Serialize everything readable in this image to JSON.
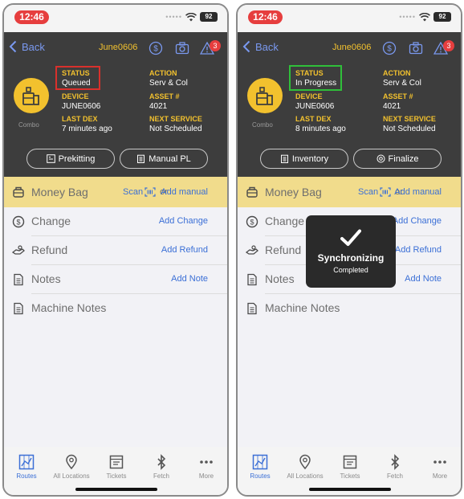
{
  "screens": [
    {
      "status_bar": {
        "time": "12:46",
        "battery": "92"
      },
      "nav": {
        "back_label": "Back",
        "title": "June0606",
        "alert_count": "3"
      },
      "header": {
        "machine_type": "Combo",
        "status_label": "STATUS",
        "status_value": "Queued",
        "action_label": "ACTION",
        "action_value": "Serv & Col",
        "device_label": "DEVICE",
        "device_value": "JUNE0606",
        "asset_label": "ASSET #",
        "asset_value": "4021",
        "lastdex_label": "LAST DEX",
        "lastdex_value": "7 minutes ago",
        "nextservice_label": "NEXT SERVICE",
        "nextservice_value": "Not Scheduled",
        "status_highlight_color": "#d9302c",
        "button_left": "Prekitting",
        "button_right": "Manual PL"
      },
      "rows": {
        "money_bag": {
          "label": "Money Bag",
          "scan": "Scan",
          "or": "or",
          "add": "Add manual"
        },
        "change": {
          "label": "Change",
          "action": "Add Change"
        },
        "refund": {
          "label": "Refund",
          "action": "Add Refund"
        },
        "notes": {
          "label": "Notes",
          "action": "Add Note"
        },
        "machine_notes": {
          "label": "Machine Notes"
        }
      }
    },
    {
      "status_bar": {
        "time": "12:46",
        "battery": "92"
      },
      "nav": {
        "back_label": "Back",
        "title": "June0606",
        "alert_count": "3"
      },
      "header": {
        "machine_type": "Combo",
        "status_label": "STATUS",
        "status_value": "In Progress",
        "action_label": "ACTION",
        "action_value": "Serv & Col",
        "device_label": "DEVICE",
        "device_value": "JUNE0606",
        "asset_label": "ASSET #",
        "asset_value": "4021",
        "lastdex_label": "LAST DEX",
        "lastdex_value": "8 minutes ago",
        "nextservice_label": "NEXT SERVICE",
        "nextservice_value": "Not Scheduled",
        "status_highlight_color": "#2fbf3a",
        "button_left": "Inventory",
        "button_right": "Finalize"
      },
      "rows": {
        "money_bag": {
          "label": "Money Bag",
          "scan": "Scan",
          "or": "or",
          "add": "Add manual"
        },
        "change": {
          "label": "Change",
          "action": "Add Change"
        },
        "refund": {
          "label": "Refund",
          "action": "Add Refund"
        },
        "notes": {
          "label": "Notes",
          "action": "Add Note"
        },
        "machine_notes": {
          "label": "Machine Notes"
        }
      },
      "toast": {
        "title": "Synchronizing",
        "subtitle": "Completed"
      }
    }
  ],
  "tabs": [
    {
      "label": "Routes",
      "icon": "routes-map-icon",
      "active": true
    },
    {
      "label": "All Locations",
      "icon": "location-pin-icon",
      "active": false
    },
    {
      "label": "Tickets",
      "icon": "tickets-icon",
      "active": false
    },
    {
      "label": "Fetch",
      "icon": "bluetooth-icon",
      "active": false
    },
    {
      "label": "More",
      "icon": "more-dots-icon",
      "active": false
    }
  ],
  "colors": {
    "accent_yellow": "#f2c12e",
    "header_dark": "#3d3d3d",
    "link_blue": "#3b6fd6",
    "money_bag_bg": "#f1dc8c",
    "alert_red": "#e63e3e"
  }
}
